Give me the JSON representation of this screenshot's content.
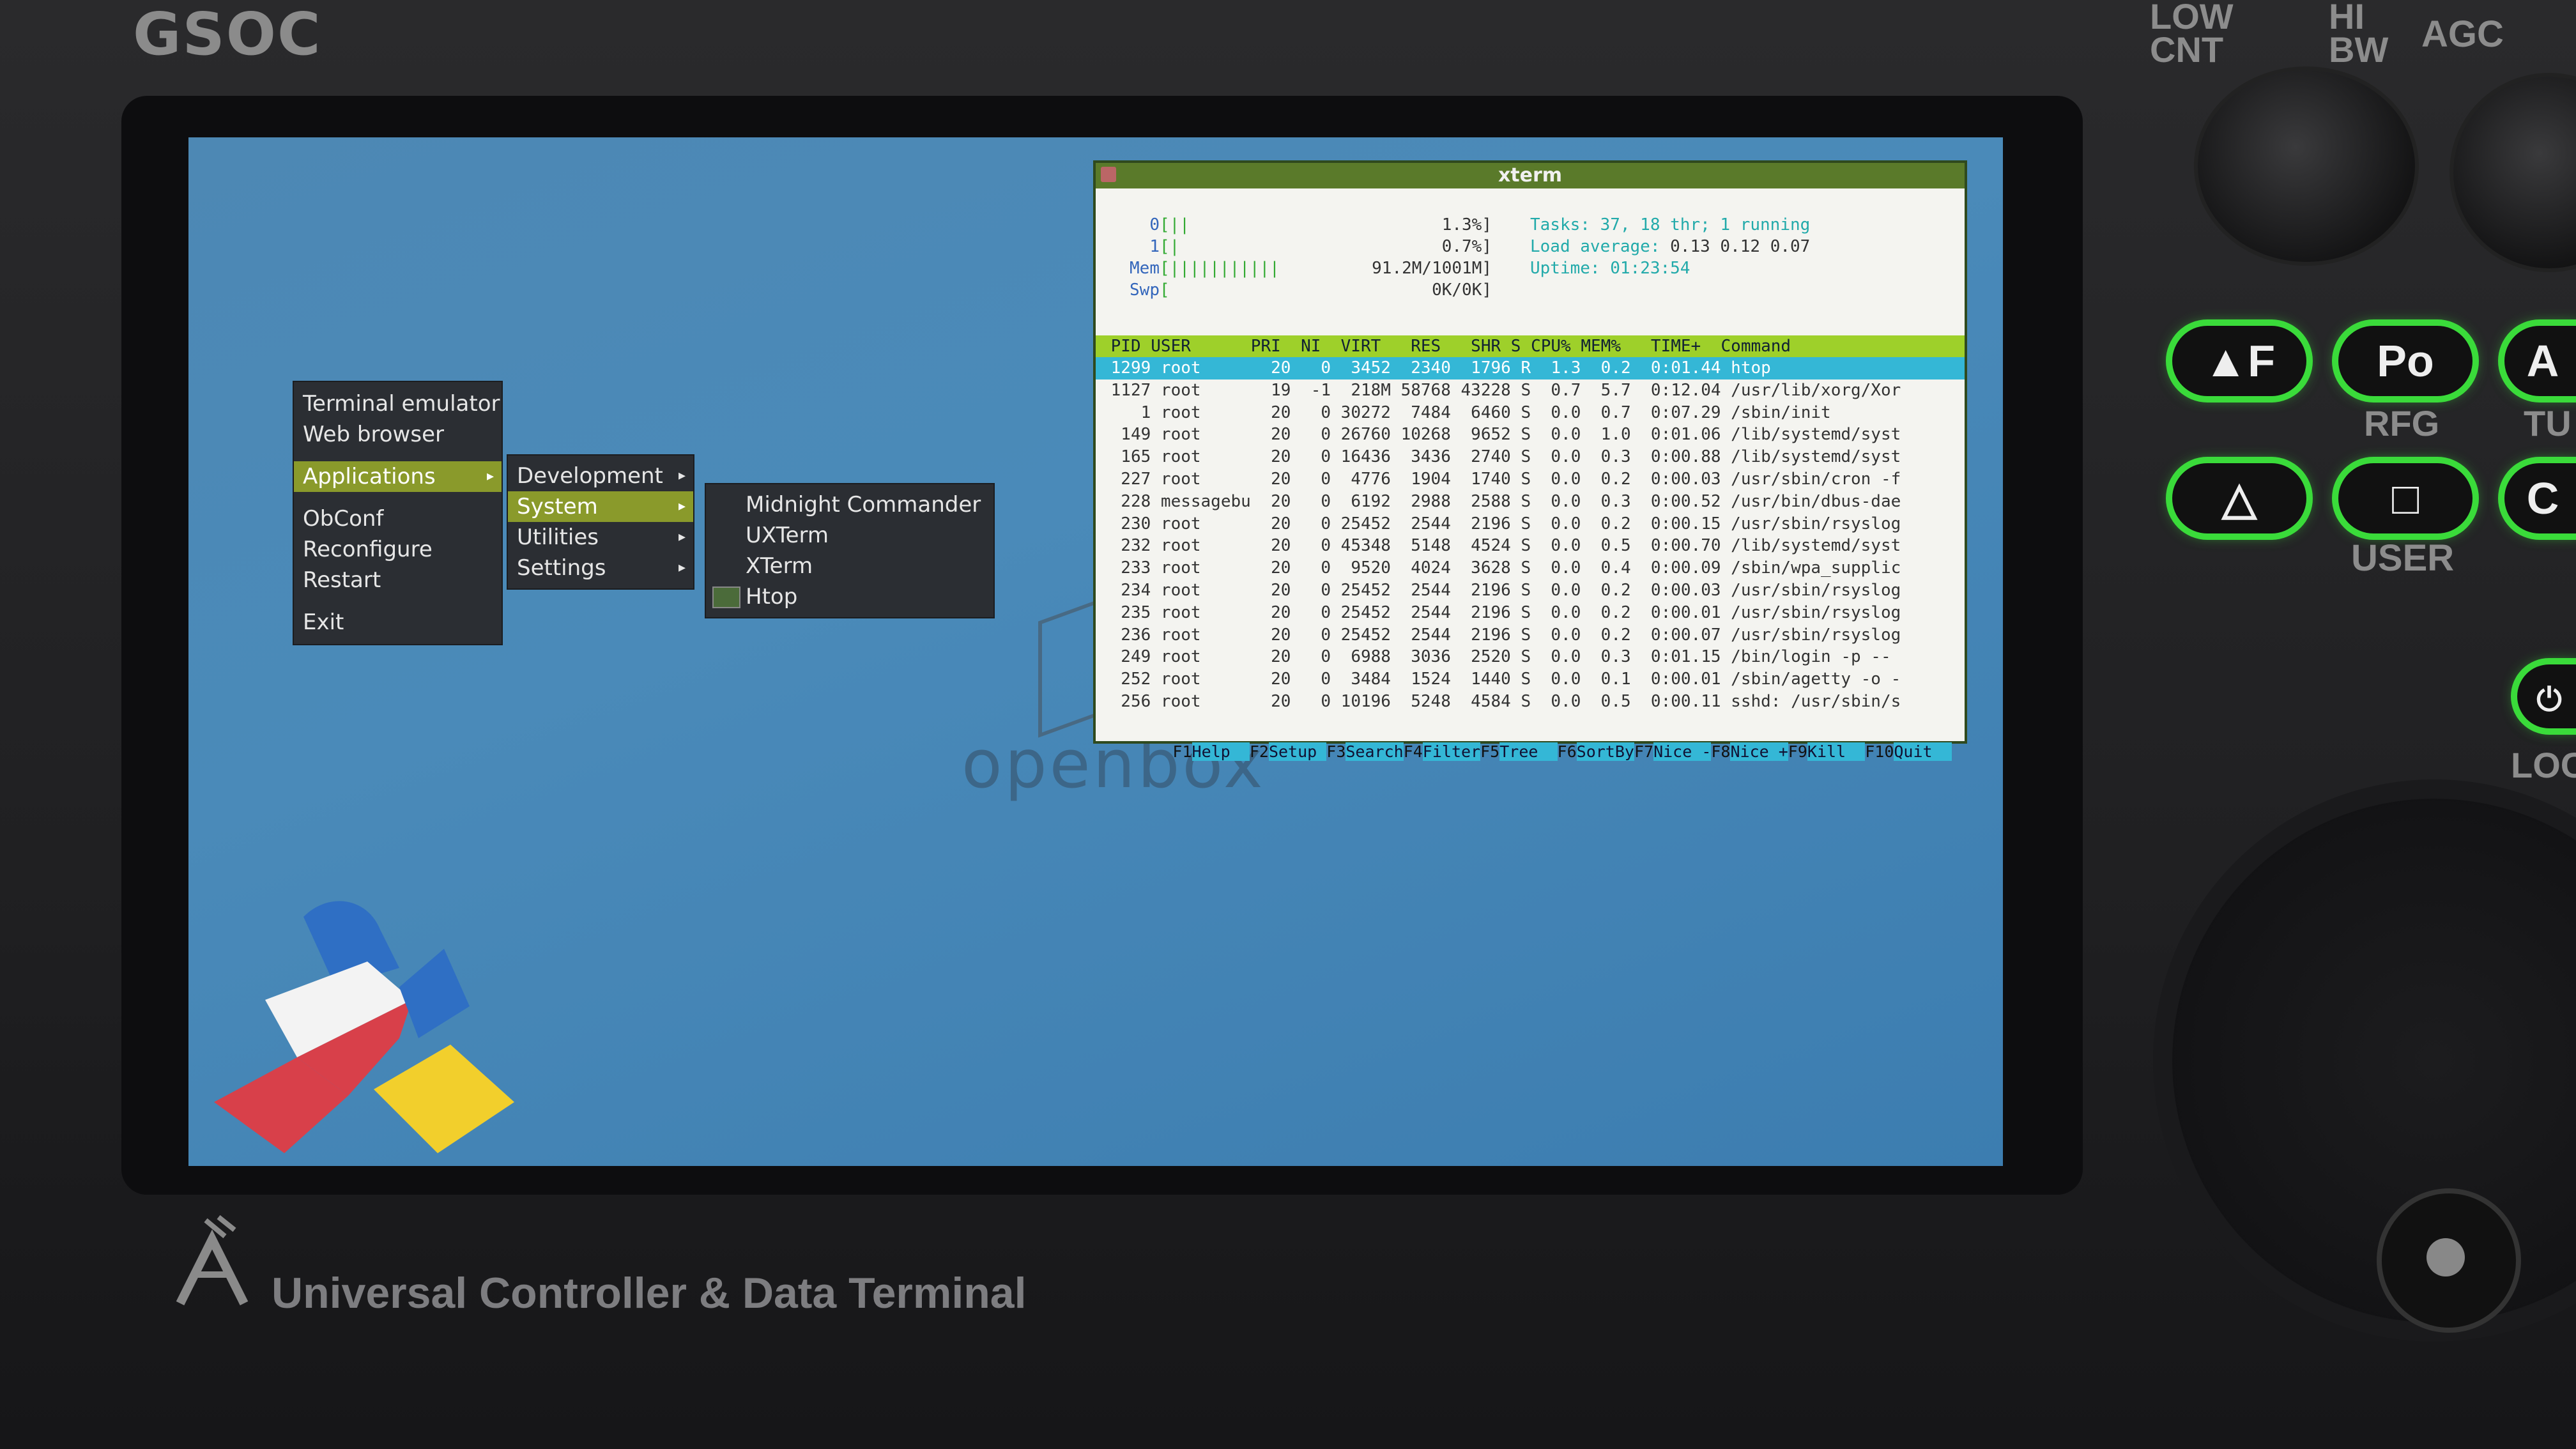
{
  "device": {
    "brand": "GSOC",
    "footer_text": "Universal Controller & Data Terminal",
    "labels": {
      "low_cnt": "LOW CNT",
      "hi_bw": "HI BW",
      "agc": "AGC",
      "rfg": "RFG",
      "tu": "TU",
      "user": "USER",
      "loc": "LOC"
    },
    "buttons": [
      "▲F",
      "Po",
      "A",
      "△",
      "□",
      "C"
    ]
  },
  "desktop": {
    "wm_logo": "openbox"
  },
  "root_menu": {
    "items": [
      "Terminal emulator",
      "Web browser",
      "Applications",
      "ObConf",
      "Reconfigure",
      "Restart",
      "Exit"
    ]
  },
  "apps_menu": {
    "items": [
      "Development",
      "System",
      "Utilities",
      "Settings"
    ]
  },
  "system_menu": {
    "items": [
      "Midnight Commander",
      "UXTerm",
      "XTerm",
      "Htop"
    ]
  },
  "xterm": {
    "title": "xterm",
    "cpu0": {
      "label": "0",
      "bar": "[||",
      "value": "1.3%]"
    },
    "cpu1": {
      "label": "1",
      "bar": "[|",
      "value": "0.7%]"
    },
    "mem": {
      "label": "Mem",
      "bar": "[|||||||||||",
      "value": "91.2M/1001M]"
    },
    "swp": {
      "label": "Swp",
      "bar": "[",
      "value": "0K/0K]"
    },
    "tasks_line": "Tasks: 37, 18 thr; 1 running",
    "load_label": "Load average:",
    "load_values": "0.13 0.12 0.07",
    "uptime_label": "Uptime:",
    "uptime_value": "01:23:54",
    "header": " PID USER      PRI  NI  VIRT   RES   SHR S CPU% MEM%   TIME+  Command",
    "rows": [
      " 1299 root       20   0  3452  2340  1796 R  1.3  0.2  0:01.44 htop",
      " 1127 root       19  -1  218M 58768 43228 S  0.7  5.7  0:12.04 /usr/lib/xorg/Xor",
      "    1 root       20   0 30272  7484  6460 S  0.0  0.7  0:07.29 /sbin/init",
      "  149 root       20   0 26760 10268  9652 S  0.0  1.0  0:01.06 /lib/systemd/syst",
      "  165 root       20   0 16436  3436  2740 S  0.0  0.3  0:00.88 /lib/systemd/syst",
      "  227 root       20   0  4776  1904  1740 S  0.0  0.2  0:00.03 /usr/sbin/cron -f",
      "  228 messagebu  20   0  6192  2988  2588 S  0.0  0.3  0:00.52 /usr/bin/dbus-dae",
      "  230 root       20   0 25452  2544  2196 S  0.0  0.2  0:00.15 /usr/sbin/rsyslog",
      "  232 root       20   0 45348  5148  4524 S  0.0  0.5  0:00.70 /lib/systemd/syst",
      "  233 root       20   0  9520  4024  3628 S  0.0  0.4  0:00.09 /sbin/wpa_supplic",
      "  234 root       20   0 25452  2544  2196 S  0.0  0.2  0:00.03 /usr/sbin/rsyslog",
      "  235 root       20   0 25452  2544  2196 S  0.0  0.2  0:00.01 /usr/sbin/rsyslog",
      "  236 root       20   0 25452  2544  2196 S  0.0  0.2  0:00.07 /usr/sbin/rsyslog",
      "  249 root       20   0  6988  3036  2520 S  0.0  0.3  0:01.15 /bin/login -p --",
      "  252 root       20   0  3484  1524  1440 S  0.0  0.1  0:00.01 /sbin/agetty -o -",
      "  256 root       20   0 10196  5248  4584 S  0.0  0.5  0:00.11 sshd: /usr/sbin/s"
    ],
    "fkeys": [
      {
        "key": "F1",
        "label": "Help  "
      },
      {
        "key": "F2",
        "label": "Setup "
      },
      {
        "key": "F3",
        "label": "Search"
      },
      {
        "key": "F4",
        "label": "Filter"
      },
      {
        "key": "F5",
        "label": "Tree  "
      },
      {
        "key": "F6",
        "label": "SortBy"
      },
      {
        "key": "F7",
        "label": "Nice -"
      },
      {
        "key": "F8",
        "label": "Nice +"
      },
      {
        "key": "F9",
        "label": "Kill  "
      },
      {
        "key": "F10",
        "label": "Quit  "
      }
    ]
  }
}
